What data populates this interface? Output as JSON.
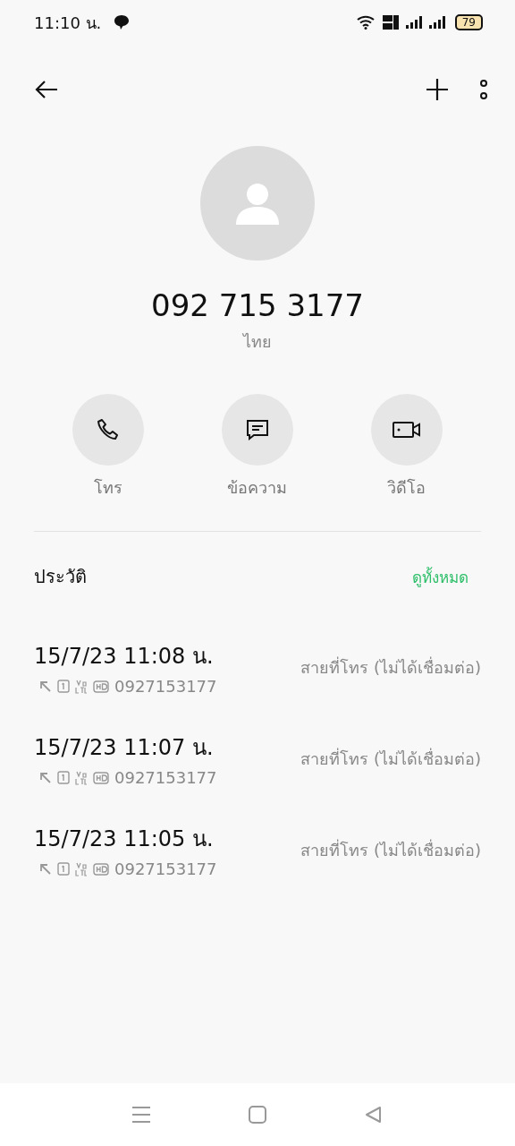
{
  "status_bar": {
    "time": "11:10 น.",
    "battery": "79"
  },
  "contact": {
    "number": "092 715 3177",
    "location": "ไทย"
  },
  "actions": [
    {
      "kind": "call",
      "label": "โทร"
    },
    {
      "kind": "message",
      "label": "ข้อความ"
    },
    {
      "kind": "video",
      "label": "วิดีโอ"
    }
  ],
  "history": {
    "title": "ประวัติ",
    "view_all": "ดูทั้งหมด",
    "entries": [
      {
        "datetime": "15/7/23 11:08 น.",
        "number": "0927153177",
        "status": "สายที่โทร (ไม่ได้เชื่อมต่อ)"
      },
      {
        "datetime": "15/7/23 11:07 น.",
        "number": "0927153177",
        "status": "สายที่โทร (ไม่ได้เชื่อมต่อ)"
      },
      {
        "datetime": "15/7/23 11:05 น.",
        "number": "0927153177",
        "status": "สายที่โทร (ไม่ได้เชื่อมต่อ)"
      }
    ]
  }
}
